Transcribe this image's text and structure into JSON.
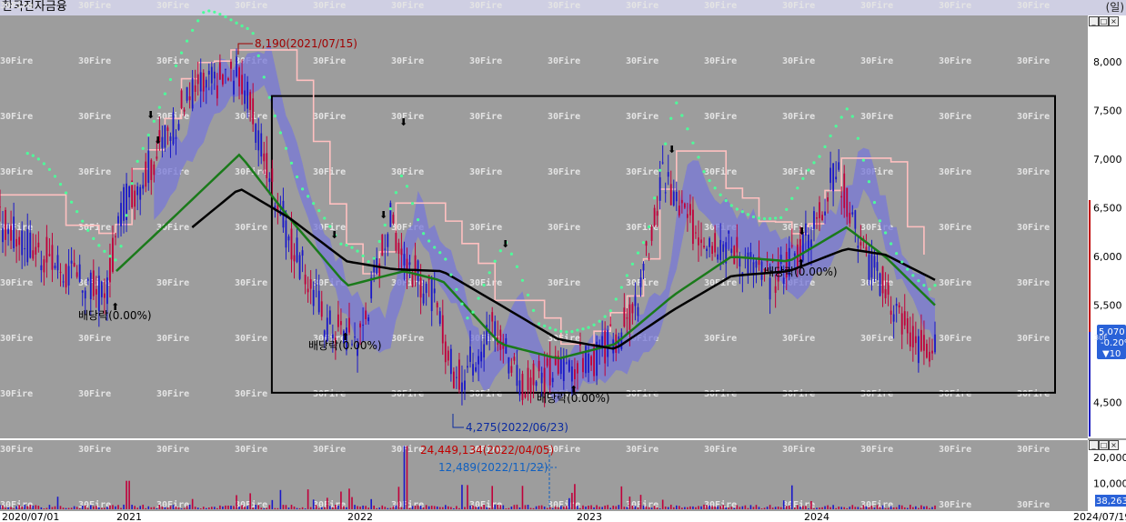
{
  "window": {
    "stock_name": "한국전자금융",
    "period": "(일)"
  },
  "watermark": "30Fire",
  "colors": {
    "background": "#9d9d9d",
    "up_candle": "#c0003a",
    "down_candle": "#1a18c8",
    "ma_long": "#000000",
    "ma_mid": "#1a7a1a",
    "parabolic": "#4cff9a",
    "envelope": "#ffc0c0",
    "cloud": "#7878d8",
    "box": "#000000"
  },
  "chart_data": [
    {
      "type": "candlestick",
      "name": "price",
      "x_ticks": [
        "2020/07/01",
        "2021",
        "2022",
        "2023",
        "2024",
        "2024/07/19"
      ],
      "y_ticks": [
        "8,000",
        "7,500",
        "7,000",
        "6,500",
        "6,000",
        "5,500",
        "4,500"
      ],
      "ylim": [
        4150,
        8450
      ],
      "price_path": [
        [
          "2020/07/01",
          6350
        ],
        [
          "2020/09/01",
          6050
        ],
        [
          "2020/11/01",
          5750
        ],
        [
          "2020/12/15",
          5600
        ],
        [
          "2021/01/10",
          6500
        ],
        [
          "2021/03/01",
          7000
        ],
        [
          "2021/05/01",
          7700
        ],
        [
          "2021/07/15",
          7900
        ],
        [
          "2021/08/15",
          7200
        ],
        [
          "2021/10/01",
          6200
        ],
        [
          "2021/12/01",
          5300
        ],
        [
          "2022/01/20",
          5150
        ],
        [
          "2022/03/10",
          6400
        ],
        [
          "2022/04/10",
          5900
        ],
        [
          "2022/05/15",
          5600
        ],
        [
          "2022/06/23",
          4700
        ],
        [
          "2022/08/20",
          5300
        ],
        [
          "2022/10/10",
          4650
        ],
        [
          "2022/12/15",
          4900
        ],
        [
          "2023/02/01",
          4950
        ],
        [
          "2023/04/01",
          5400
        ],
        [
          "2023/05/15",
          6800
        ],
        [
          "2023/07/01",
          6300
        ],
        [
          "2023/09/01",
          6100
        ],
        [
          "2023/11/01",
          5750
        ],
        [
          "2024/01/01",
          6200
        ],
        [
          "2024/02/15",
          6900
        ],
        [
          "2024/04/01",
          6000
        ],
        [
          "2024/05/15",
          5500
        ],
        [
          "2024/06/20",
          5100
        ],
        [
          "2024/07/19",
          5050
        ]
      ],
      "ma_long": [
        [
          "2021/05/01",
          6300
        ],
        [
          "2021/07/15",
          6700
        ],
        [
          "2021/10/01",
          6400
        ],
        [
          "2022/01/01",
          5950
        ],
        [
          "2022/03/15",
          5870
        ],
        [
          "2022/06/01",
          5850
        ],
        [
          "2022/09/01",
          5500
        ],
        [
          "2022/12/01",
          5150
        ],
        [
          "2023/03/01",
          5050
        ],
        [
          "2023/06/01",
          5450
        ],
        [
          "2023/09/01",
          5800
        ],
        [
          "2023/12/01",
          5850
        ],
        [
          "2024/03/01",
          6080
        ],
        [
          "2024/05/01",
          6020
        ],
        [
          "2024/07/19",
          5760
        ]
      ],
      "ma_mid": [
        [
          "2021/01/01",
          5850
        ],
        [
          "2021/04/01",
          6400
        ],
        [
          "2021/07/15",
          7050
        ],
        [
          "2021/10/01",
          6400
        ],
        [
          "2022/01/01",
          5700
        ],
        [
          "2022/04/01",
          5850
        ],
        [
          "2022/06/01",
          5750
        ],
        [
          "2022/09/01",
          5100
        ],
        [
          "2022/12/01",
          4950
        ],
        [
          "2023/03/01",
          5100
        ],
        [
          "2023/06/01",
          5600
        ],
        [
          "2023/09/01",
          6000
        ],
        [
          "2023/12/01",
          5950
        ],
        [
          "2024/03/01",
          6300
        ],
        [
          "2024/05/01",
          6000
        ],
        [
          "2024/07/19",
          5500
        ]
      ],
      "box": {
        "x_start": "2021/01/01",
        "x_end": "2024/07/19",
        "y_low": 4600,
        "y_high": 7650
      },
      "annotations": [
        {
          "kind": "high",
          "text": "8,190(2021/07/15)",
          "color": "#a00000"
        },
        {
          "kind": "low",
          "text": "4,275(2022/06/23)",
          "color": "#0a2aa0"
        },
        {
          "kind": "dividend",
          "text": "배당락(0.00%)",
          "color": "#000000"
        },
        {
          "kind": "dividend",
          "text": "배당락(0.00%)",
          "color": "#000000"
        },
        {
          "kind": "dividend",
          "text": "배당락(0.00%)",
          "color": "#000000"
        },
        {
          "kind": "dividend",
          "text": "배당락(0.00%)",
          "color": "#000000"
        }
      ],
      "current_values": {
        "price": "5,070",
        "change": "-0.20%",
        "change_amount": "▼10",
        "overlay": "30F"
      }
    },
    {
      "type": "bar",
      "name": "volume",
      "y_ticks": [
        "20,000",
        "10,000"
      ],
      "ylim": [
        0,
        26000
      ],
      "annotations": [
        {
          "kind": "max",
          "text": "24,449,134(2022/04/05)",
          "color": "#c00000"
        },
        {
          "kind": "min",
          "text": "12,489(2022/11/22)",
          "color": "#1060c0"
        }
      ],
      "current_value": "38,263"
    }
  ]
}
